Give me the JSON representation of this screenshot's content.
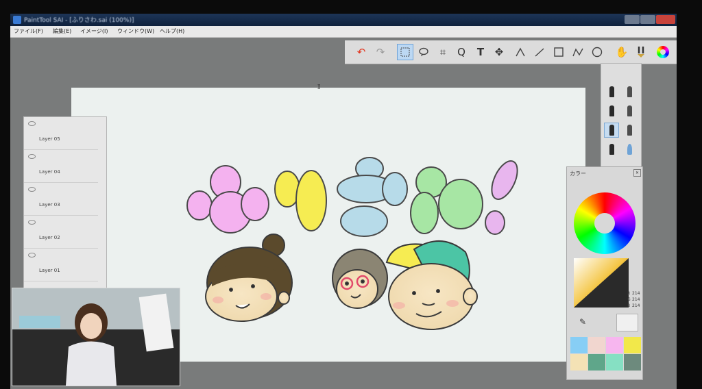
{
  "window": {
    "title": "PaintTool SAI - [ふりさわ.sai (100%)]",
    "menu": [
      "ファイル(F)",
      "編集(E)",
      "イメージ(I)",
      "ウィンドウ(W)",
      "ヘルプ(H)"
    ]
  },
  "toolbar": {
    "tools": [
      "undo-icon",
      "redo-icon",
      "select-rect-icon",
      "lasso-icon",
      "crop-icon",
      "zoom-icon",
      "text-icon",
      "move-icon",
      "pen-line-icon",
      "line-icon",
      "rect-icon",
      "polyline-icon",
      "ellipse-icon",
      "hand-icon",
      "brush-icon",
      "color-wheel-icon"
    ],
    "active_tool": "select-rect-icon"
  },
  "layers": {
    "items": [
      "Layer 05",
      "Layer 04",
      "Layer 03",
      "Layer 02",
      "Layer 01"
    ]
  },
  "color_panel": {
    "title": "カラー",
    "rgb": {
      "r_label": "R",
      "g_label": "G",
      "b_label": "B",
      "r": "214",
      "g": "214",
      "b": "214"
    },
    "swatches": [
      "#87cef5",
      "#f1d6cf",
      "#f7b6ef",
      "#f2e84a",
      "#f4e2b5",
      "#5fa68a",
      "#86e0c3",
      "#6d8a7d"
    ]
  },
  "canvas": {
    "letters": [
      "ふ",
      "り",
      "さ",
      "わ",
      "!"
    ],
    "letter_colors": [
      "#f4b2ef",
      "#f6ec52",
      "#b7dbe9",
      "#a7e6a4",
      "#e8b6ee"
    ]
  },
  "colors": {
    "workspace": "#797b7b",
    "canvas": "#ecf1ef",
    "titlebar": "#0f213d"
  }
}
